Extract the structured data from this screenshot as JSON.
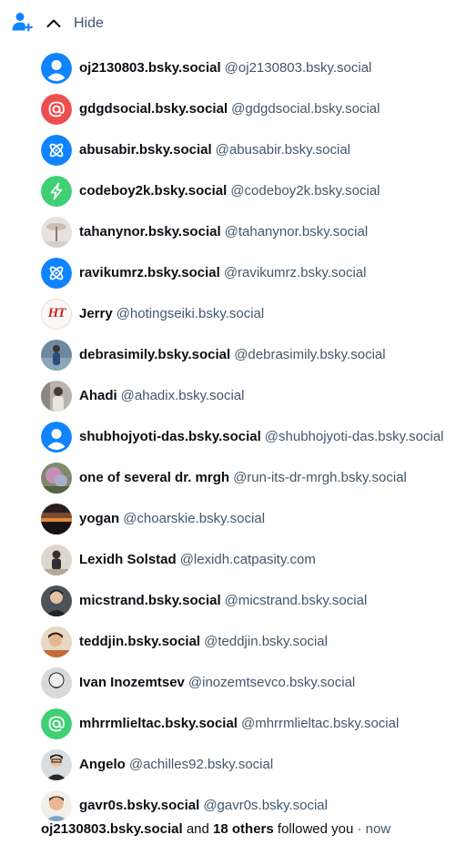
{
  "header": {
    "follow_icon": "person-plus-icon",
    "toggle_icon": "chevron-up-icon",
    "toggle_label": "Hide",
    "accent_color": "#1083fe"
  },
  "followers": [
    {
      "display_name": "oj2130803.bsky.social",
      "handle": "@oj2130803.bsky.social",
      "avatar": "default-user-avatar"
    },
    {
      "display_name": "gdgdsocial.bsky.social",
      "handle": "@gdgdsocial.bsky.social",
      "avatar": "at-sign-avatar-red"
    },
    {
      "display_name": "abusabir.bsky.social",
      "handle": "@abusabir.bsky.social",
      "avatar": "atom-avatar-blue"
    },
    {
      "display_name": "codeboy2k.bsky.social",
      "handle": "@codeboy2k.bsky.social",
      "avatar": "bolt-avatar-green"
    },
    {
      "display_name": "tahanynor.bsky.social",
      "handle": "@tahanynor.bsky.social",
      "avatar": "photo-avatar"
    },
    {
      "display_name": "ravikumrz.bsky.social",
      "handle": "@ravikumrz.bsky.social",
      "avatar": "atom-avatar-blue"
    },
    {
      "display_name": "Jerry",
      "handle": "@hotingseiki.bsky.social",
      "avatar": "logo-avatar",
      "logo_text": "HT"
    },
    {
      "display_name": "debrasimily.bsky.social",
      "handle": "@debrasimily.bsky.social",
      "avatar": "photo-avatar"
    },
    {
      "display_name": "Ahadi",
      "handle": "@ahadix.bsky.social",
      "avatar": "photo-avatar"
    },
    {
      "display_name": "shubhojyoti-das.bsky.social",
      "handle": "@shubhojyoti-das.bsky.social",
      "avatar": "default-user-avatar"
    },
    {
      "display_name": "one of several dr. mrgh",
      "handle": "@run-its-dr-mrgh.bsky.social",
      "avatar": "photo-avatar"
    },
    {
      "display_name": "yogan",
      "handle": "@choarskie.bsky.social",
      "avatar": "photo-avatar"
    },
    {
      "display_name": "Lexidh Solstad",
      "handle": "@lexidh.catpasity.com",
      "avatar": "photo-avatar"
    },
    {
      "display_name": "micstrand.bsky.social",
      "handle": "@micstrand.bsky.social",
      "avatar": "photo-avatar"
    },
    {
      "display_name": "teddjin.bsky.social",
      "handle": "@teddjin.bsky.social",
      "avatar": "photo-avatar"
    },
    {
      "display_name": "Ivan Inozemtsev",
      "handle": "@inozemtsevco.bsky.social",
      "avatar": "photo-avatar"
    },
    {
      "display_name": "mhrrmlieltac.bsky.social",
      "handle": "@mhrrmlieltac.bsky.social",
      "avatar": "at-sign-avatar-green"
    },
    {
      "display_name": "Angelo",
      "handle": "@achilles92.bsky.social",
      "avatar": "photo-avatar"
    },
    {
      "display_name": "gavr0s.bsky.social",
      "handle": "@gavr0s.bsky.social",
      "avatar": "photo-avatar"
    }
  ],
  "footer": {
    "first_name": "oj2130803.bsky.social",
    "and_text": "and",
    "others_text": "18 others",
    "followed_text": "followed you",
    "separator": "·",
    "time": "now"
  },
  "colors": {
    "text_primary": "#0b0f14",
    "text_muted": "#42576c",
    "blue": "#1083fe",
    "red": "#ef4e4e",
    "green": "#3fcf74"
  }
}
